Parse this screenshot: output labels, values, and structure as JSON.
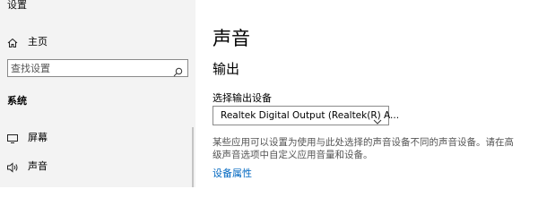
{
  "window": {
    "title": "设置"
  },
  "sidebar": {
    "home_label": "主页",
    "search_placeholder": "查找设置",
    "section_label": "系统",
    "items": [
      {
        "label": "屏幕",
        "icon": "monitor-icon"
      },
      {
        "label": "声音",
        "icon": "speaker-icon"
      }
    ]
  },
  "main": {
    "page_title": "声音",
    "output_heading": "输出",
    "device_label": "选择输出设备",
    "device_selected": "Realtek Digital Output (Realtek(R) A...",
    "description": "某些应用可以设置为使用与此处选择的声音设备不同的声音设备。请在高级声音选项中自定义应用音量和设备。",
    "device_properties_link": "设备属性"
  },
  "colors": {
    "sidebar_bg": "#f3f3f3",
    "link": "#0067c0",
    "desc_text": "#555555"
  }
}
